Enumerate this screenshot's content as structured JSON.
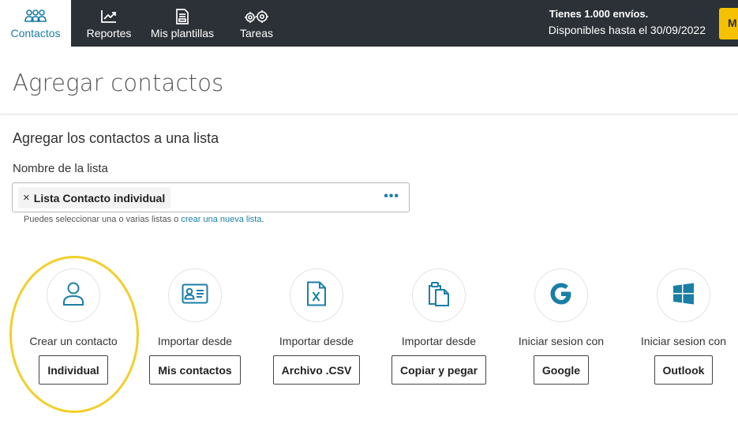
{
  "nav": {
    "items": [
      {
        "label": "Contactos",
        "icon": "users-icon",
        "active": true
      },
      {
        "label": "Reportes",
        "icon": "chart-icon"
      },
      {
        "label": "Mis plantillas",
        "icon": "template-icon"
      },
      {
        "label": "Tareas",
        "icon": "gears-icon"
      }
    ],
    "envios_line1": "Tienes 1.000 envíos.",
    "envios_line2": "Disponibles hasta el 30/09/2022",
    "account_initial": "M"
  },
  "page": {
    "title": "Agregar contactos",
    "section_title": "Agregar los contactos a una lista",
    "field_label": "Nombre de la lista",
    "selected_list": "Lista Contacto individual",
    "tag_remove": "×",
    "more": "•••",
    "help_text": "Puedes seleccionar una o varias listas o ",
    "help_link": "crear una nueva lista",
    "help_end": "."
  },
  "options": [
    {
      "caption": "Crear un contacto",
      "button": "Individual",
      "icon": "user-icon"
    },
    {
      "caption": "Importar desde",
      "button": "Mis contactos",
      "icon": "contact-card-icon"
    },
    {
      "caption": "Importar desde",
      "button": "Archivo .CSV",
      "icon": "excel-file-icon"
    },
    {
      "caption": "Importar desde",
      "button": "Copiar y pegar",
      "icon": "clipboard-icon"
    },
    {
      "caption": "Iniciar sesion con",
      "button": "Google",
      "icon": "google-icon"
    },
    {
      "caption": "Iniciar sesion con",
      "button": "Outlook",
      "icon": "windows-icon"
    }
  ],
  "colors": {
    "nav_bg": "#2c3137",
    "accent": "#1a7fa6",
    "account_bg": "#f5c100",
    "highlight": "#f2cf2a"
  }
}
